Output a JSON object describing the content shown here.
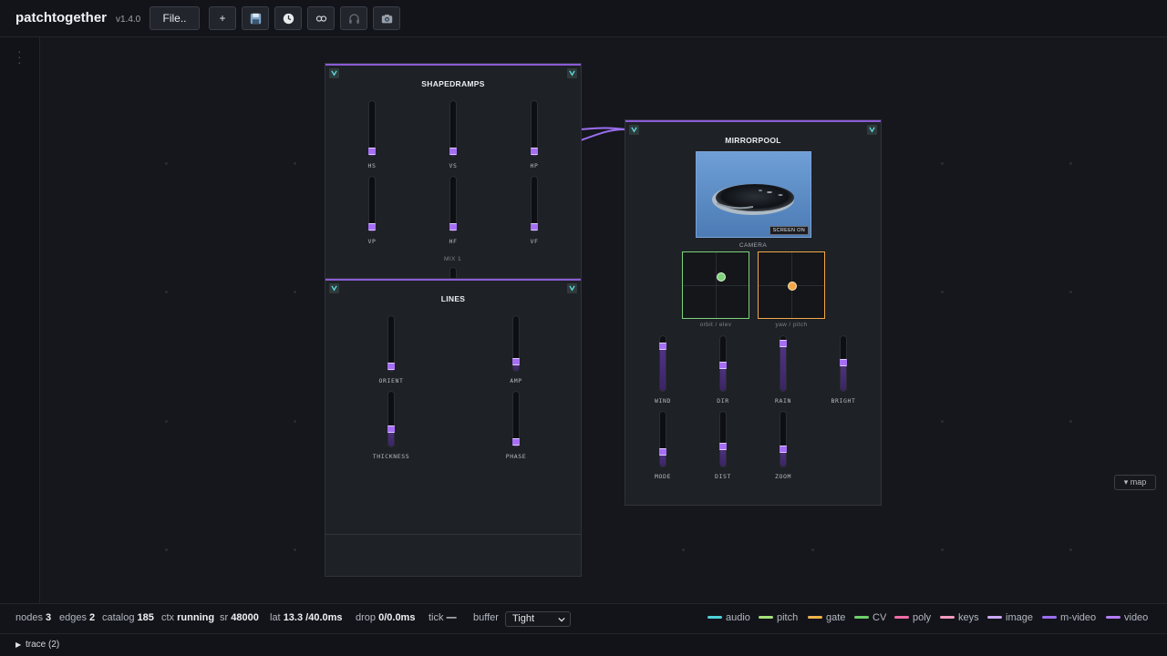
{
  "app": {
    "title": "patchtogether",
    "version": "v1.4.0"
  },
  "toolbar": {
    "file_label": "File..",
    "add_label": "+",
    "icons": [
      "save-icon",
      "history-icon",
      "link-icon",
      "headphones-icon",
      "camera-icon"
    ]
  },
  "panels": {
    "shapedramps": {
      "title": "SHAPEDRAMPS",
      "sliders": [
        {
          "label": "HS",
          "value": 0.05
        },
        {
          "label": "VS",
          "value": 0.05
        },
        {
          "label": "HP",
          "value": 0.05
        },
        {
          "label": "VP",
          "value": 0.05
        },
        {
          "label": "HF",
          "value": 0.1
        },
        {
          "label": "VF",
          "value": 0.1
        }
      ],
      "mix_label": "MIX 1"
    },
    "lines": {
      "title": "LINES",
      "sliders": [
        {
          "label": "ORIENT",
          "value": 0.05
        },
        {
          "label": "AMP",
          "value": 0.2
        },
        {
          "label": "THICKNESS",
          "value": 0.35
        },
        {
          "label": "PHASE",
          "value": 0.05
        }
      ]
    },
    "mirrorpool": {
      "title": "MIRRORPOOL",
      "screen_button": "SCREEN ON",
      "camera_label": "CAMERA",
      "pad_orbit_label": "orbit / elev",
      "pad_yaw_label": "yaw / pitch",
      "pad_orbit_color": "#7ed27a",
      "pad_yaw_color": "#f0a847",
      "sliders": [
        {
          "label": "WIND",
          "value": 0.85
        },
        {
          "label": "DIR",
          "value": 0.5
        },
        {
          "label": "RAIN",
          "value": 0.9
        },
        {
          "label": "BRIGHT",
          "value": 0.55
        },
        {
          "label": "MODE",
          "value": 0.3
        },
        {
          "label": "DIST",
          "value": 0.4
        },
        {
          "label": "ZOOM",
          "value": 0.35
        }
      ]
    }
  },
  "map_label": "▾ map",
  "status": {
    "nodes_label": "nodes",
    "nodes": "3",
    "edges_label": "edges",
    "edges": "2",
    "catalog_label": "catalog",
    "catalog": "185",
    "ctx_label": "ctx",
    "ctx": "running",
    "sr_label": "sr",
    "sr": "48000",
    "lat_label": "lat",
    "lat": "13.3",
    "lat_max": "/40.0ms",
    "drop_label": "drop",
    "drop": "0/0.0ms",
    "tick_label": "tick",
    "tick": "—",
    "buffer_label": "buffer",
    "buffer": "Tight"
  },
  "legend": [
    {
      "label": "audio",
      "color": "#4fd1d9"
    },
    {
      "label": "pitch",
      "color": "#a3e07a"
    },
    {
      "label": "gate",
      "color": "#f0b34a"
    },
    {
      "label": "CV",
      "color": "#6fcf6a"
    },
    {
      "label": "poly",
      "color": "#f06ba8"
    },
    {
      "label": "keys",
      "color": "#f59ac0"
    },
    {
      "label": "image",
      "color": "#c9a8f5"
    },
    {
      "label": "m-video",
      "color": "#9b6ef0"
    },
    {
      "label": "video",
      "color": "#b57cf7"
    }
  ],
  "trace": {
    "label": "trace (2)"
  }
}
